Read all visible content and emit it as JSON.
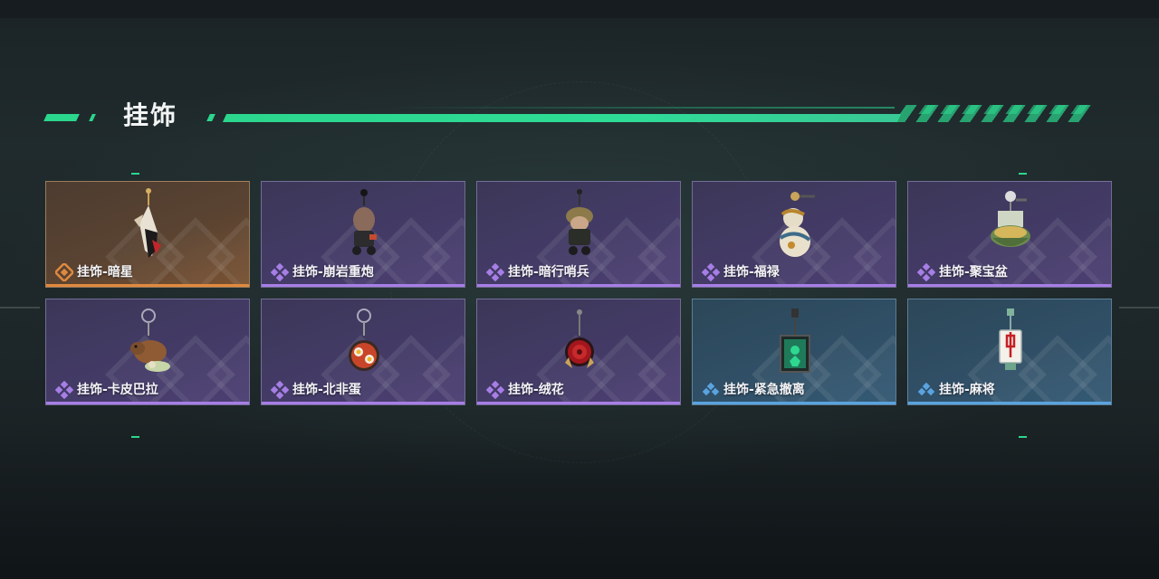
{
  "section": {
    "title": "挂饰"
  },
  "colors": {
    "accent": "#2bd68d",
    "rarity_gold": "#e0893e",
    "rarity_purple": "#a77ee6",
    "rarity_blue": "#59a3e0"
  },
  "items": [
    {
      "name": "挂饰-暗星",
      "rarity": "gold",
      "icon": "dark-star-pendant-icon"
    },
    {
      "name": "挂饰-崩岩重炮",
      "rarity": "purple",
      "icon": "rock-cannon-pendant-icon"
    },
    {
      "name": "挂饰-暗行哨兵",
      "rarity": "purple",
      "icon": "shadow-sentry-pendant-icon"
    },
    {
      "name": "挂饰-福禄",
      "rarity": "purple",
      "icon": "gourd-fortune-pendant-icon"
    },
    {
      "name": "挂饰-聚宝盆",
      "rarity": "purple",
      "icon": "treasure-bowl-pendant-icon"
    },
    {
      "name": "挂饰-卡皮巴拉",
      "rarity": "purple",
      "icon": "capybara-pendant-icon"
    },
    {
      "name": "挂饰-北非蛋",
      "rarity": "purple",
      "icon": "shakshuka-pendant-icon"
    },
    {
      "name": "挂饰-绒花",
      "rarity": "purple",
      "icon": "velvet-flower-pendant-icon"
    },
    {
      "name": "挂饰-紧急撤离",
      "rarity": "blue",
      "icon": "emergency-evac-pendant-icon"
    },
    {
      "name": "挂饰-麻将",
      "rarity": "blue",
      "icon": "mahjong-tile-pendant-icon"
    }
  ]
}
